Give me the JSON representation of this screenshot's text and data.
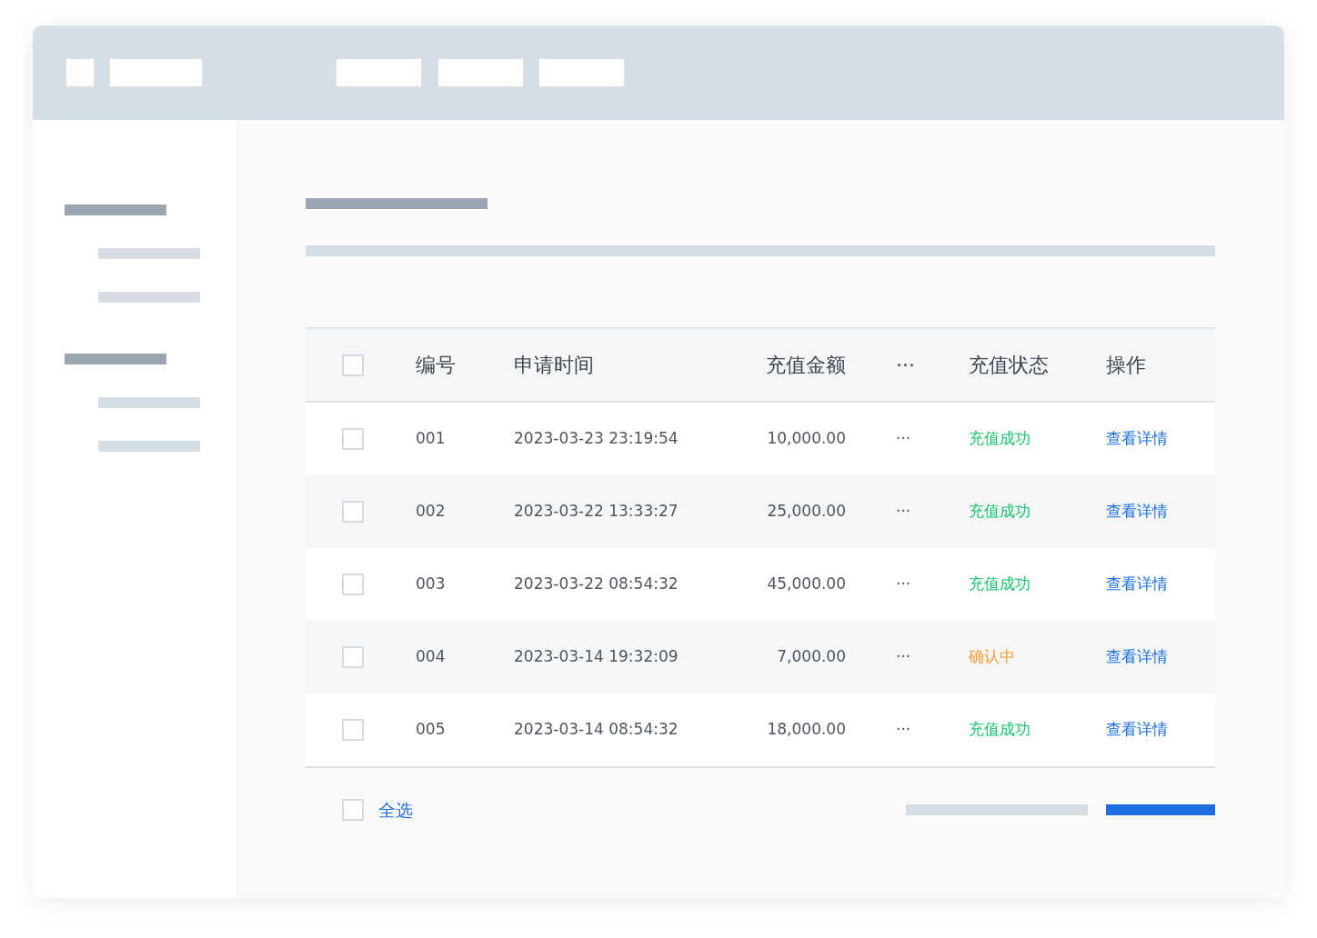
{
  "table": {
    "columns": [
      {
        "label": "编号"
      },
      {
        "label": "申请时间"
      },
      {
        "label": "充值金额"
      },
      {
        "label": "···"
      },
      {
        "label": "充值状态"
      },
      {
        "label": "操作"
      }
    ],
    "header_checked": false,
    "rows": [
      {
        "checked": false,
        "id": "001",
        "time": "2023-03-23 23:19:54",
        "amount": "10,000.00",
        "more": "···",
        "status": "充值成功",
        "color": "#19c46a",
        "action": "查看详情"
      },
      {
        "checked": false,
        "id": "002",
        "time": "2023-03-22 13:33:27",
        "amount": "25,000.00",
        "more": "···",
        "status": "充值成功",
        "color": "#19c46a",
        "action": "查看详情"
      },
      {
        "checked": false,
        "id": "003",
        "time": "2023-03-22 08:54:32",
        "amount": "45,000.00",
        "more": "···",
        "status": "充值成功",
        "color": "#19c46a",
        "action": "查看详情"
      },
      {
        "checked": false,
        "id": "004",
        "time": "2023-03-14 19:32:09",
        "amount": "7,000.00",
        "more": "···",
        "status": "确认中",
        "color": "#ff9a2e",
        "action": "查看详情"
      },
      {
        "checked": false,
        "id": "005",
        "time": "2023-03-14 08:54:32",
        "amount": "18,000.00",
        "more": "···",
        "status": "充值成功",
        "color": "#19c46a",
        "action": "查看详情"
      }
    ]
  },
  "footer": {
    "select_all": {
      "label": "全选",
      "checked": false
    }
  }
}
